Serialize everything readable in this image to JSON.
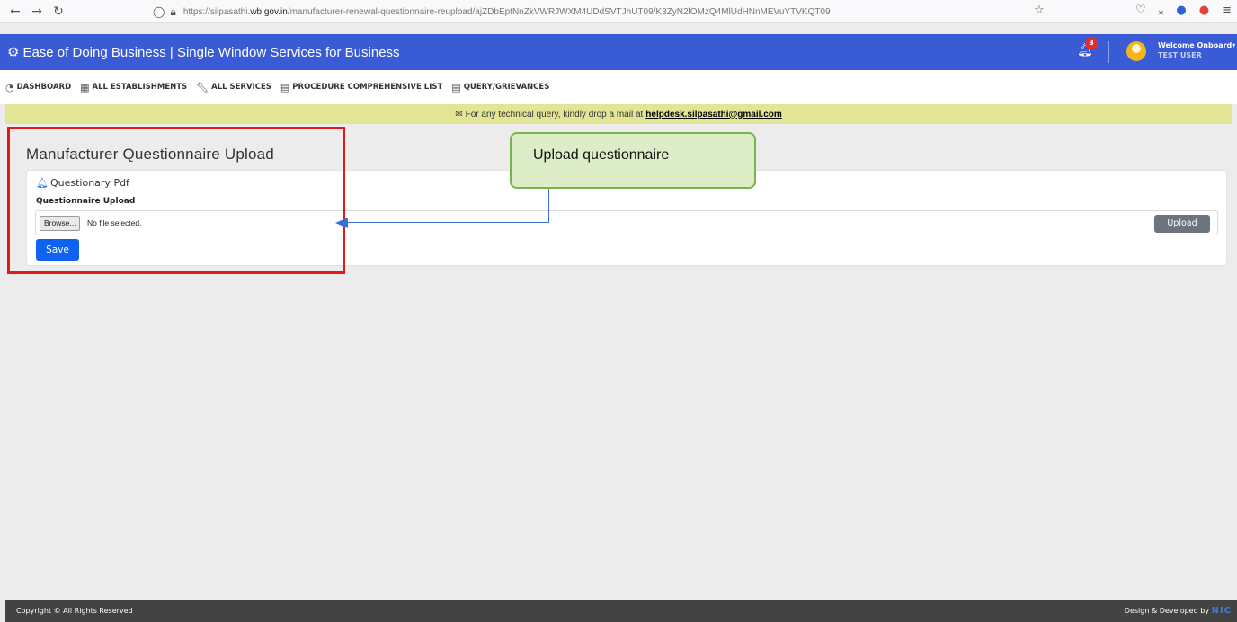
{
  "browser": {
    "url_prefix": "https://silpasathi.",
    "url_domain": "wb.gov.in",
    "url_path": "/manufacturer-renewal-questionnaire-reupload/ajZDbEptNnZkVWRJWXM4UDdSVTJhUT09/K3ZyN2lOMzQ4MlUdHNnMEVuYTVKQT09"
  },
  "header": {
    "title": "Ease of Doing Business | Single Window Services for Business",
    "notification_count": "3",
    "welcome": "Welcome Onboard",
    "user": "TEST USER"
  },
  "nav": [
    {
      "label": "DASHBOARD",
      "icon": "gauge-icon"
    },
    {
      "label": "ALL ESTABLISHMENTS",
      "icon": "building-icon"
    },
    {
      "label": "ALL SERVICES",
      "icon": "wrench-icon"
    },
    {
      "label": "PROCEDURE COMPREHENSIVE LIST",
      "icon": "list-icon"
    },
    {
      "label": "QUERY/GRIEVANCES",
      "icon": "list-icon"
    }
  ],
  "notice": {
    "text": "For any technical query, kindly drop a mail at",
    "email": "helpdesk.silpasathi@gmail.com"
  },
  "page": {
    "title": "Manufacturer Questionnaire Upload",
    "card_heading": "Questionary Pdf",
    "field_label": "Questionnaire Upload",
    "browse_label": "Browse...",
    "file_status": "No file selected.",
    "upload_label": "Upload",
    "save_label": "Save"
  },
  "annotation": {
    "callout_text": "Upload questionnaire",
    "highlight_color": "#e61717",
    "callout_border": "#7ab24b",
    "arrow_color": "#3b6fd6"
  },
  "footer": {
    "left": "Copyright © All Rights Reserved",
    "right": "Design & Developed by",
    "brand": "NIC"
  },
  "colors": {
    "header_bg": "#3a5bd6",
    "notice_bg": "#e3e596",
    "save_btn": "#1062f0",
    "upload_btn": "#6c757d"
  }
}
